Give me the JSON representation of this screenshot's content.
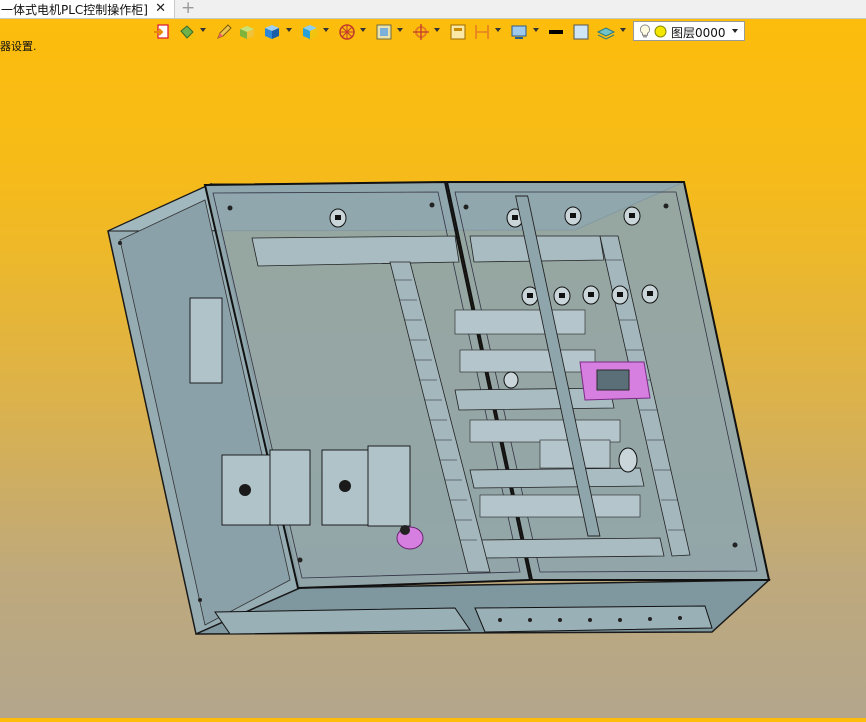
{
  "tab": {
    "title": "一体式电机PLC控制操作柜]",
    "close_glyph": "✕",
    "add_glyph": "+"
  },
  "hint": {
    "text": "器设置."
  },
  "toolbar": {
    "icons": [
      "import-icon",
      "paint-bucket-icon",
      "pencil-icon",
      "box-icon",
      "cube-icon",
      "cube-color-icon",
      "wheel-icon",
      "frame-icon",
      "target-icon",
      "panel-icon",
      "dimension-icon",
      "display-icon",
      "line-style-icon",
      "fill-color-icon",
      "layer-stack-icon"
    ]
  },
  "layer": {
    "value": "图层0000",
    "bulb_icon": "lightbulb-icon",
    "color_icon": "yellow-circle-icon"
  },
  "colors": {
    "background_top": "#fdbd0a",
    "background_bottom": "#b3a68c",
    "cabinet": "#8fa6ad",
    "highlight": "#d67fe0"
  }
}
